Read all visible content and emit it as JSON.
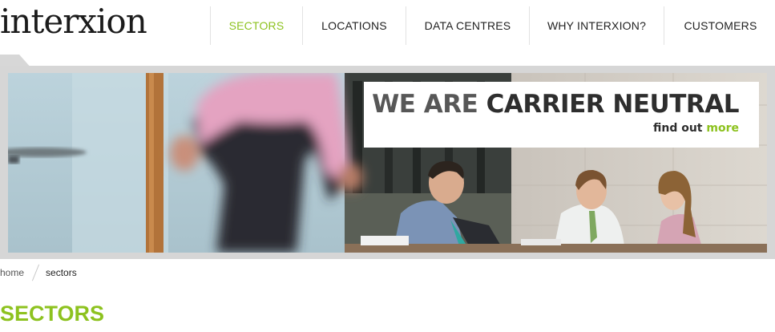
{
  "header": {
    "logo_text": "interxion",
    "nav": [
      {
        "label": "SECTORS",
        "active": true
      },
      {
        "label": "LOCATIONS",
        "active": false
      },
      {
        "label": "DATA CENTRES",
        "active": false
      },
      {
        "label": "WHY INTERXION?",
        "active": false
      },
      {
        "label": "CUSTOMERS",
        "active": false
      }
    ]
  },
  "banner": {
    "heading_light": "WE ARE",
    "heading_dark": "CARRIER NEUTRAL",
    "link_dark": "find out",
    "link_green": "more"
  },
  "breadcrumb": {
    "home": "home",
    "current": "sectors"
  },
  "page": {
    "title": "SECTORS"
  },
  "colors": {
    "brand_green": "#8dc21f",
    "text_dark": "#222222",
    "frame_grey": "#d6d6d6"
  }
}
